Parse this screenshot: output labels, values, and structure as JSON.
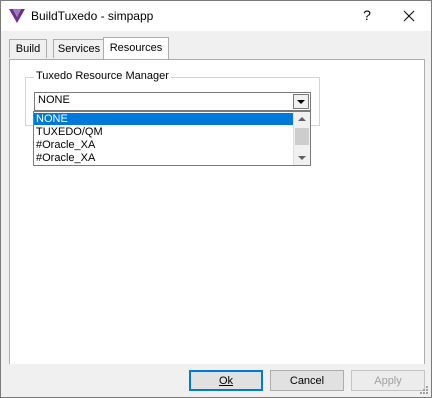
{
  "window": {
    "title": "BuildTuxedo - simpapp",
    "help_label": "?"
  },
  "tabs": [
    {
      "label": "Build"
    },
    {
      "label": "Services"
    },
    {
      "label": "Resources",
      "active": true
    }
  ],
  "resources": {
    "group_label": "Tuxedo Resource Manager",
    "combo_value": "NONE",
    "options": [
      "NONE",
      "TUXEDO/QM",
      "#Oracle_XA",
      "#Oracle_XA"
    ],
    "selected_index": 0
  },
  "buttons": {
    "ok": "Ok",
    "cancel": "Cancel",
    "apply": "Apply"
  },
  "colors": {
    "selection": "#0078d7",
    "icon_purple": "#6b2f8f"
  }
}
